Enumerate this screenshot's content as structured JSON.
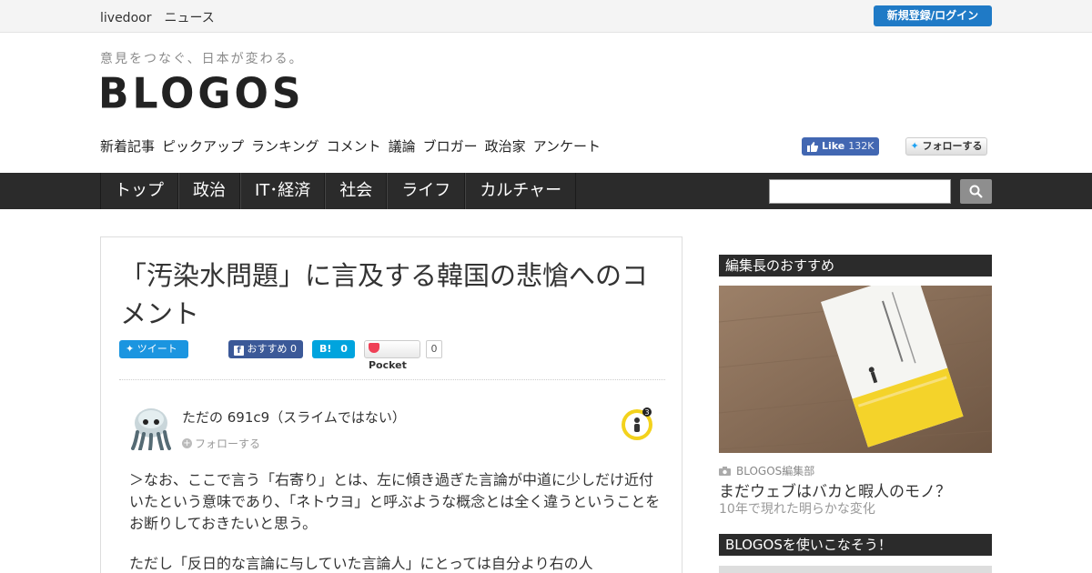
{
  "topbar": {
    "brand": "livedoor　ニュース",
    "login_label": "新規登録/ログイン"
  },
  "header": {
    "tagline": "意見をつなぐ、日本が変わる。",
    "logo": "BLOGOS",
    "category_nav": [
      "新着記事",
      "ピックアップ",
      "ランキング",
      "コメント",
      "議論",
      "ブロガー",
      "政治家",
      "アンケート"
    ],
    "fb_like": {
      "label": "Like",
      "count": "132K"
    },
    "twitter_follow": "フォローする"
  },
  "main_nav": {
    "tabs": [
      "トップ",
      "政治",
      "IT･経済",
      "社会",
      "ライフ",
      "カルチャー"
    ],
    "search_placeholder": ""
  },
  "article": {
    "title": "「汚染水問題」に言及する韓国の悲愴へのコメント",
    "share": {
      "tweet": "ツイート",
      "fb_recommend": "おすすめ",
      "fb_count": "0",
      "hatena_label": "B!",
      "hatena_count": "0",
      "pocket_label": "Pocket",
      "pocket_count": "0"
    },
    "author": {
      "name": "ただの 691c9（スライムではない）",
      "follow": "フォローする",
      "badge_count": "3"
    },
    "paragraphs": [
      "＞なお、ここで言う「右寄り」とは、左に傾き過ぎた言論が中道に少しだけ近付いたという意味であり、「ネトウヨ」と呼ぶような概念とは全く違うということをお断りしておきたいと思う。",
      "ただし「反日的な言論に与していた言論人」にとっては自分より右の人"
    ]
  },
  "sidebar": {
    "editor_pick_heading": "編集長のおすすめ",
    "pick": {
      "author": "BLOGOS編集部",
      "title": "まだウェブはバカと暇人のモノ？",
      "subtitle": "10年で現れた明らかな変化"
    },
    "guide_heading": "BLOGOSを使いこなそう！"
  },
  "colors": {
    "nav_dark": "#2b2b2b",
    "login_blue": "#1f7ac6",
    "tweet_blue": "#1b95e0",
    "fb_blue": "#3b5998",
    "hatena_blue": "#00a4de"
  }
}
